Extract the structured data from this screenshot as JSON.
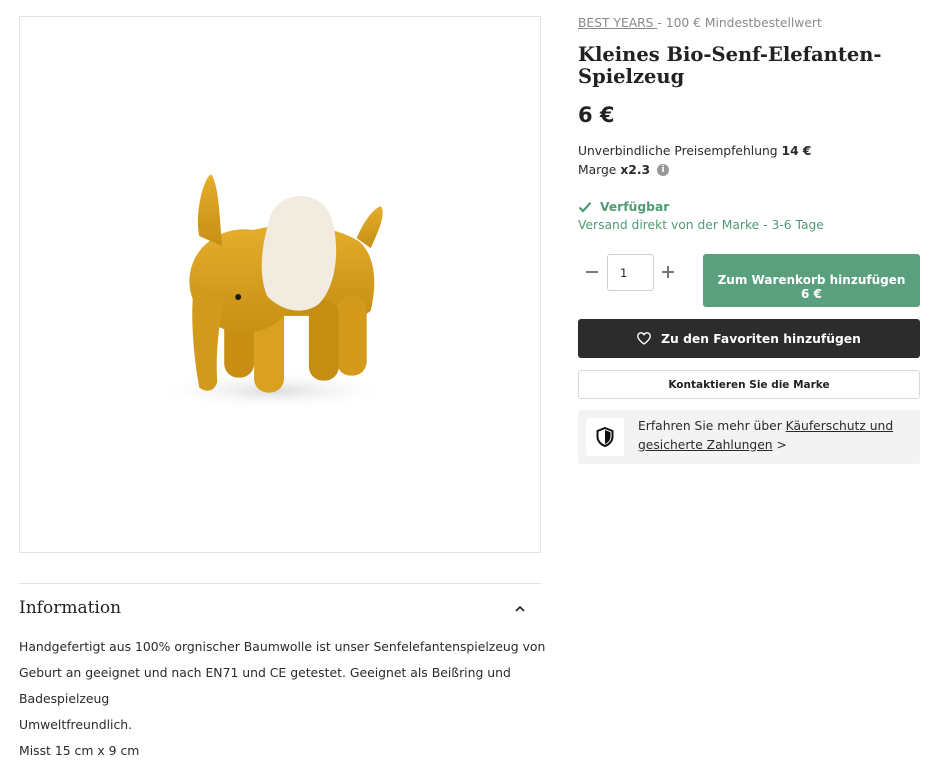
{
  "product_image": {
    "alt_icon": "elephant-toy-image"
  },
  "brand": {
    "name": "BEST YEARS ",
    "separator": "-",
    "min_order": "100 € Mindestbestellwert"
  },
  "product": {
    "title": "Kleines Bio-Senf-Elefanten-Spielzeug",
    "price": "6 €"
  },
  "rrp": {
    "label": "Unverbindliche Preisempfehlung",
    "value": "14 €"
  },
  "margin": {
    "label": "Marge",
    "value": "x2.3",
    "info_icon": "i"
  },
  "availability": {
    "status": "Verfügbar",
    "shipping": "Versand direkt von der Marke - 3-6 Tage",
    "color": "#4f9b75"
  },
  "cart": {
    "quantity": "1",
    "button_line1": "Zum Warenkorb hinzufügen",
    "button_line2": "6 €",
    "accent": "#5aa07f"
  },
  "favorites": {
    "label": "Zu den Favoriten hinzufügen"
  },
  "contact": {
    "label": "Kontaktieren Sie die Marke"
  },
  "protection": {
    "prefix": "Erfahren Sie mehr über ",
    "link": "Käuferschutz und gesicherte Zahlungen",
    "arrow": ">"
  },
  "information": {
    "heading": "Information",
    "description": "Handgefertigt aus 100% orgnischer Baumwolle ist unser Senfelefantenspielzeug von Geburt an geeignet und nach EN71 und CE getestet. Geeignet als Beißring und Badespielzeug",
    "line2": "Umweltfreundlich.",
    "line3": "Misst 15 cm x 9 cm"
  }
}
